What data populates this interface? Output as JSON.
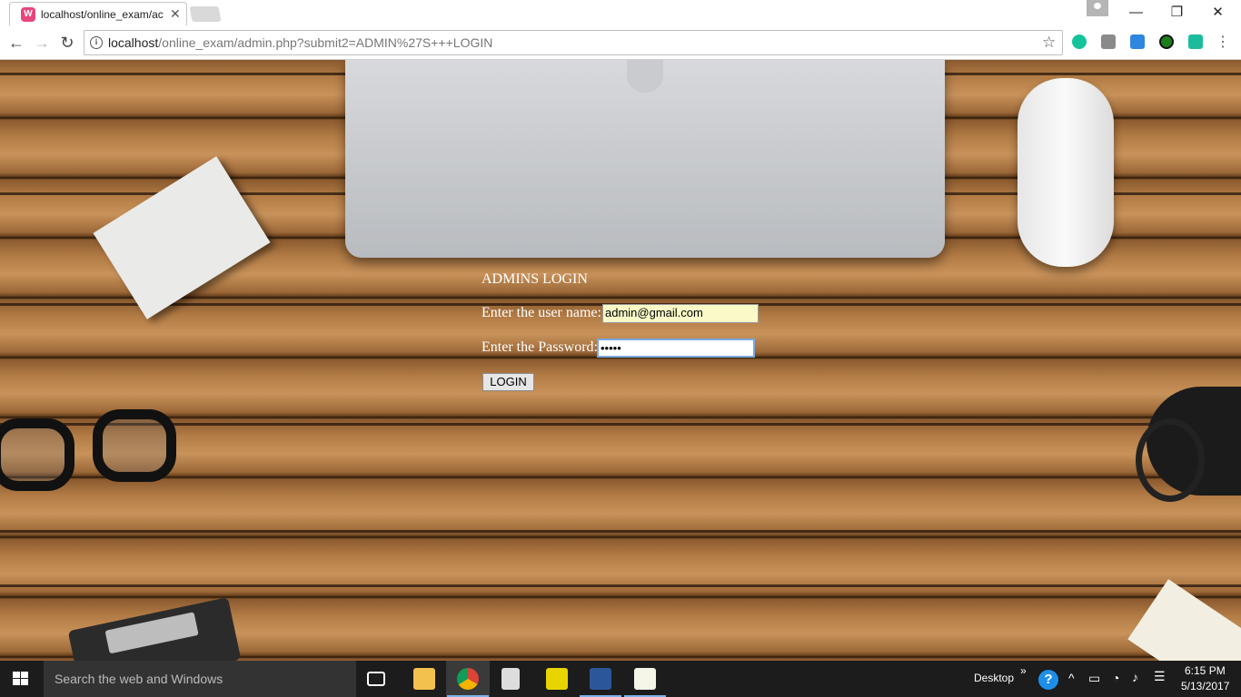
{
  "browser": {
    "tab_title": "localhost/online_exam/ac",
    "url_host": "localhost",
    "url_path": "/online_exam/admin.php?submit2=ADMIN%27S+++LOGIN",
    "icons": {
      "back": "back-arrow-icon",
      "forward": "forward-arrow-icon",
      "reload": "reload-icon",
      "star": "bookmark-star-icon",
      "menu": "more-menu-icon"
    },
    "extensions": [
      {
        "name": "grammarly-extension-icon",
        "color": "#15c39a"
      },
      {
        "name": "extension-icon-2",
        "color": "#8a8a8a"
      },
      {
        "name": "extension-icon-3",
        "color": "#2e86de"
      },
      {
        "name": "extension-icon-4",
        "color": "#1a7f1a"
      },
      {
        "name": "extension-icon-5",
        "color": "#1bbc9b"
      }
    ]
  },
  "form": {
    "title": "ADMINS LOGIN",
    "username_label": "Enter the user name:",
    "username_value": "admin@gmail.com",
    "password_label": "Enter the Password:",
    "password_value": "•••••",
    "login_button": "LOGIN"
  },
  "taskbar": {
    "search_placeholder": "Search the web and Windows",
    "desktop_label": "Desktop",
    "expand_symbol": "»",
    "time": "6:15 PM",
    "date": "5/13/2017"
  }
}
